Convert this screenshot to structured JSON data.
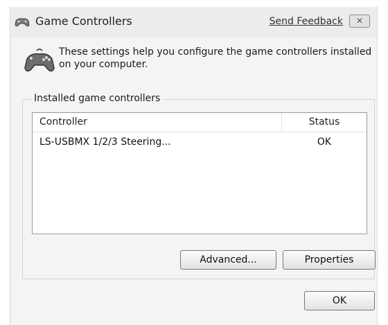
{
  "window": {
    "title": "Game Controllers",
    "feedback_label": "Send Feedback",
    "close_glyph": "✕"
  },
  "intro": {
    "text": "These settings help you configure the game controllers installed on your computer."
  },
  "controllers_group": {
    "label": "Installed game controllers",
    "columns": [
      "Controller",
      "Status"
    ],
    "rows": [
      {
        "controller": "LS-USBMX 1/2/3 Steering...",
        "status": "OK"
      }
    ]
  },
  "buttons": {
    "advanced": "Advanced...",
    "properties": "Properties",
    "ok": "OK"
  },
  "icons": {
    "title": "gamepad-icon",
    "intro": "gamepad-icon"
  }
}
